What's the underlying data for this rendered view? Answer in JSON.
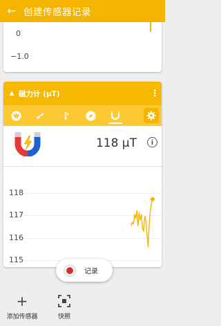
{
  "app_bar": {
    "title": "创建传感器记录",
    "back_icon": "arrow-back-icon"
  },
  "prev_card": {
    "y_ticks": [
      "0",
      "−1.0"
    ]
  },
  "sensor_card": {
    "name": "磁力计 (μT)",
    "tabs": [
      "sound-wave-icon",
      "linear-accel-icon",
      "accelerometer-icon",
      "compass-icon",
      "magnet-icon"
    ],
    "active_tab": 4,
    "reading_value": "118 μT",
    "accent_color": "#f4b400"
  },
  "chart_data": {
    "type": "line",
    "y_ticks": [
      "118",
      "117",
      "116",
      "115"
    ],
    "ylim": [
      114.8,
      118.3
    ],
    "series": [
      {
        "color": "#f4b400",
        "x": [
          0,
          1,
          2,
          3,
          4,
          5,
          6,
          7,
          8,
          9,
          10,
          11,
          12,
          13,
          14,
          15,
          16,
          17,
          18,
          19
        ],
        "values": [
          116.6,
          116.8,
          116.7,
          117.2,
          117.0,
          117.4,
          116.6,
          117.3,
          116.9,
          117.2,
          116.5,
          116.3,
          117.1,
          116.9,
          116.2,
          115.5,
          116.7,
          117.4,
          117.8,
          118.0
        ]
      }
    ]
  },
  "record_button": {
    "label": "记录"
  },
  "bottom_actions": {
    "add_sensor": "添加传感器",
    "snapshot": "快照"
  }
}
